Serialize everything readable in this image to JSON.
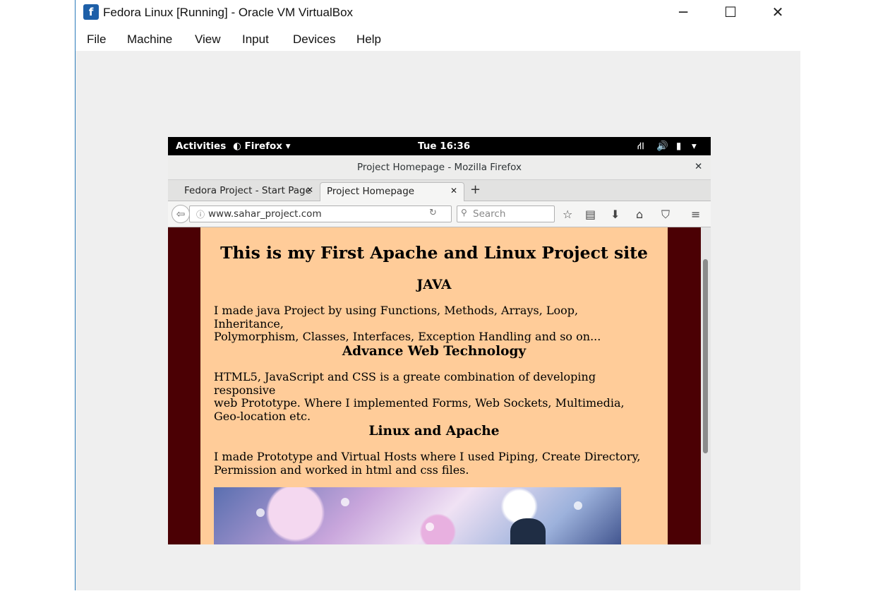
{
  "window": {
    "title": "Fedora Linux [Running] - Oracle VM VirtualBox",
    "controls": {
      "minimize": "─",
      "maximize": "☐",
      "close": "✕"
    }
  },
  "menubar": [
    "File",
    "Machine",
    "View",
    "Input",
    "Devices",
    "Help"
  ],
  "gnome_topbar": {
    "activities": "Activities",
    "app_menu": "Firefox",
    "clock": "Tue 16:36"
  },
  "firefox": {
    "window_title": "Project Homepage - Mozilla Firefox",
    "tabs": [
      {
        "label": "Fedora Project - Start Page",
        "active": false
      },
      {
        "label": "Project Homepage",
        "active": true
      }
    ],
    "url": "www.sahar_project.com",
    "search_placeholder": "Search"
  },
  "page": {
    "heading": "This is my First Apache and Linux Project site",
    "sections": [
      {
        "title": "JAVA",
        "lines": [
          "I made java Project by using Functions, Methods, Arrays, Loop, Inheritance,",
          "Polymorphism, Classes, Interfaces, Exception Handling and so on..."
        ]
      },
      {
        "title": "Advance Web Technology",
        "lines": [
          "HTML5, JavaScript and CSS is a greate combination of developing responsive",
          "web Prototype. Where I implemented Forms, Web Sockets, Multimedia,",
          "Geo-location etc."
        ]
      },
      {
        "title": "Linux and Apache",
        "lines": [
          "I made Prototype and Virtual Hosts where I used Piping, Create Directory,",
          "Permission and worked in html and css files."
        ]
      }
    ]
  },
  "colors": {
    "page_bg": "#ffcc99",
    "side_bg": "#4b0004",
    "vm_bg": "#efefef"
  }
}
